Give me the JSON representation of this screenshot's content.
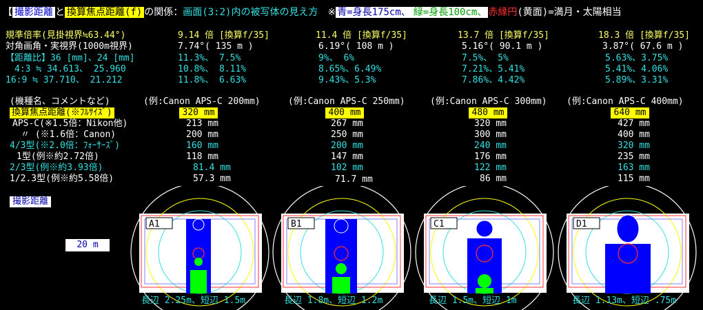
{
  "header": {
    "bracket_open": "【",
    "tag_distance": "撮影距離",
    "and": "と",
    "tag_focal": "換算焦点距離(f)",
    "relation": "の関係：",
    "frame_note": "画面(3:2)内の被写体の見え方",
    "note_prefix": "※",
    "blue_note": "青=身長175cm、",
    "green_note": "緑=身長100cm、",
    "red_note": "赤縁円",
    "red_note_rest": "(黄面)=満月・太陽相当"
  },
  "top_table": {
    "row_labels": [
      "規準倍率(見掛視界≒63.44°)",
      "対角画角・実視界(1000m視界)",
      "【距離比】36 [mm]、24 [mm]",
      "　4:3 ≒ 34.613、 25.960",
      " 16:9 ≒ 37.710、 21.212"
    ],
    "columns": [
      {
        "mag": "9.14 倍 [換算f/35]",
        "fov": "7.74°( 135 m )",
        "r1": "11.3%、 7.5%",
        "r2": "10.8%、 8.11%",
        "r3": "11.8%、 6.63%"
      },
      {
        "mag": "11.4 倍 [換算f/35]",
        "fov": "6.19°( 108 m )",
        "r1": "9%、 6%",
        "r2": "8.65%、6.49%",
        "r3": "9.43%、5.3%"
      },
      {
        "mag": "13.7 倍 [換算f/35]",
        "fov": "5.16°( 90.1 m )",
        "r1": "7.5%、 5%",
        "r2": "7.21%、5.41%",
        "r3": "7.86%、4.42%"
      },
      {
        "mag": "18.3 倍 [換算f/35]",
        "fov": "3.87°( 67.6 m )",
        "r1": "5.63%、3.75%",
        "r2": "5.41%、4.06%",
        "r3": "5.89%、3.31%"
      }
    ]
  },
  "mid_table": {
    "section_label": "(機種名、コメントなど)",
    "examples": [
      "(例:Canon APS-C 200mm)",
      "(例:Canon APS-C 250mm)",
      "(例:Canon APS-C 300mm)",
      "(例:Canon APS-C 400mm)"
    ],
    "row_labels": [
      "換算焦点距離(※ﾌﾙｻｲｽﾞ)",
      "APS-C(※1.5倍：Nikon他)",
      "〃 (※1.6倍：Canon)",
      "4/3型(※2.0倍：ﾌｫｰｻｰｽﾞ)",
      "1型(例※約2.72倍)",
      "2/3型(例※約3.93倍)",
      "1/2.3型(例※約5.58倍)"
    ],
    "values": [
      [
        "320 mm",
        "213 mm",
        "200 mm",
        "160 mm",
        "118 mm",
        "81.4 mm",
        "57.3 mm"
      ],
      [
        "400 mm",
        "267 mm",
        "250 mm",
        "200 mm",
        "147 mm",
        "102 mm",
        "71.7 mm"
      ],
      [
        "480 mm",
        "320 mm",
        "300 mm",
        "240 mm",
        "176 mm",
        "122 mm",
        "86 mm"
      ],
      [
        "640 mm",
        "427 mm",
        "400 mm",
        "320 mm",
        "235 mm",
        "163 mm",
        "115 mm"
      ]
    ]
  },
  "distance": {
    "label": "撮影距離",
    "value": "20 m"
  },
  "scenes": [
    {
      "id": "A1",
      "caption": "長辺 2.25m、短辺 1.5m"
    },
    {
      "id": "B1",
      "caption": "長辺 1.8m、短辺 1.2m"
    },
    {
      "id": "C1",
      "caption": "長辺 1.5m、短辺 1m"
    },
    {
      "id": "D1",
      "caption": "長辺 1.13m、短辺 .75m"
    }
  ],
  "colors": {
    "yellow": "#ffff66",
    "cyan": "#33e0e0",
    "blue": "#0000ff",
    "green": "#00ff00",
    "red": "#ff3030"
  }
}
